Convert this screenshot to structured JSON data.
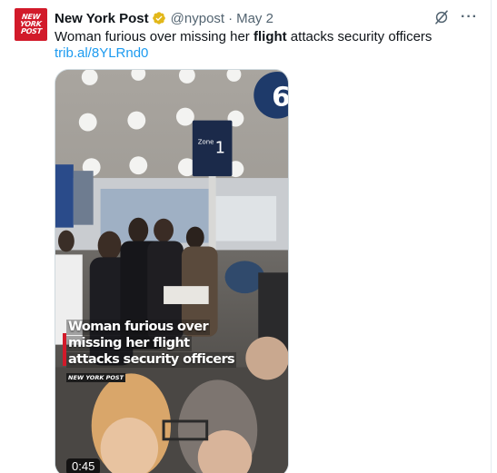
{
  "tweet": {
    "avatar_lines": [
      "NEW",
      "YORK",
      "POST"
    ],
    "display_name": "New York Post",
    "handle": "@nypost",
    "separator": "·",
    "date": "May 2",
    "text_before": "Woman furious over missing her ",
    "text_bold": "flight",
    "text_after": " attacks security officers",
    "link": "trib.al/8YLRnd0",
    "more_label": "···"
  },
  "video": {
    "caption_lines": [
      "Woman furious over",
      "missing her flight",
      "attacks security officers"
    ],
    "brand": "NEW YORK POST",
    "zone_label": "Zone",
    "zone_number": "1",
    "gate_number": "6",
    "duration": "0:45"
  },
  "icons": {
    "verified": "verified-badge-icon",
    "grok": "grok-icon",
    "more": "more-icon"
  },
  "colors": {
    "brand_red": "#d21a2a",
    "link_blue": "#1d9bf0",
    "verified_gold": "#e2b719",
    "muted": "#536471"
  }
}
